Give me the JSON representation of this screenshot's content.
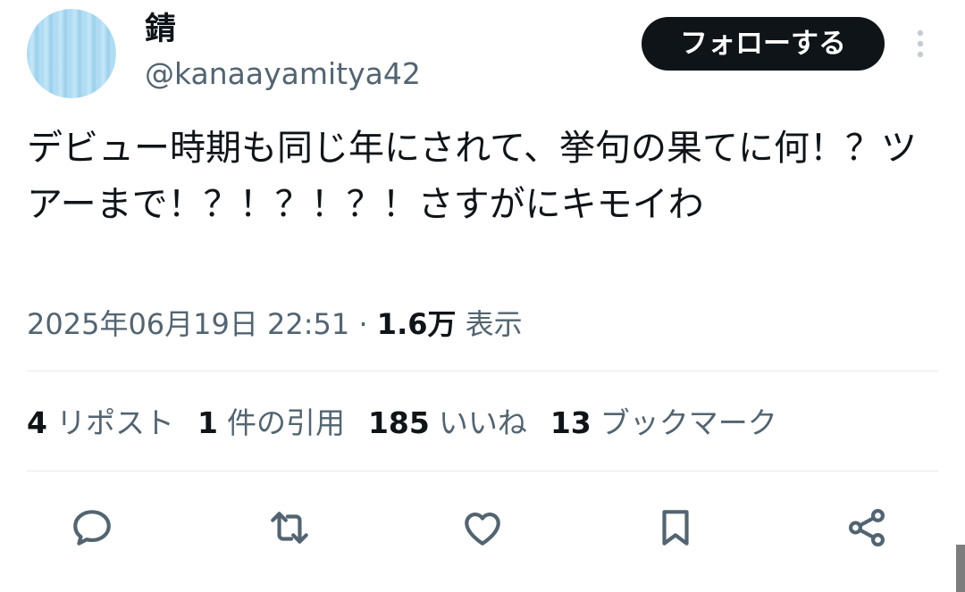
{
  "user": {
    "display_name": "錆",
    "handle": "@kanaayamitya42",
    "avatar": "light-blue-striped-avatar"
  },
  "follow_label": "フォローする",
  "tweet": {
    "text": "デビュー時期も同じ年にされて、挙句の果てに何！？ツアーまで！？！？！？！さすがにキモイわ",
    "timestamp": "2025年06月19日 22:51",
    "separator": "·",
    "views_count": "1.6万",
    "views_label": "表示"
  },
  "stats": [
    {
      "count": "4",
      "label": "リポスト"
    },
    {
      "count": "1",
      "label": "件の引用"
    },
    {
      "count": "185",
      "label": "いいね"
    },
    {
      "count": "13",
      "label": "ブックマーク"
    }
  ],
  "actions": [
    "reply-icon",
    "retweet-icon",
    "like-icon",
    "bookmark-icon",
    "share-icon"
  ],
  "colors": {
    "text": "#0f1419",
    "secondary": "#536471",
    "icon": "#536471",
    "divider": "#e4e8eb",
    "follow_bg": "#0f1419",
    "follow_text": "#ffffff"
  }
}
